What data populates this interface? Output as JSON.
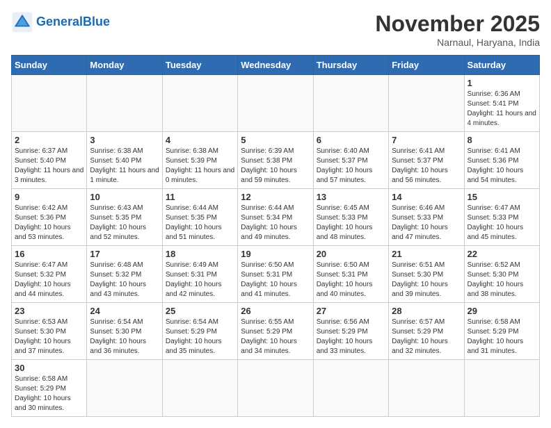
{
  "header": {
    "logo_general": "General",
    "logo_blue": "Blue",
    "month_title": "November 2025",
    "location": "Narnaul, Haryana, India"
  },
  "weekdays": [
    "Sunday",
    "Monday",
    "Tuesday",
    "Wednesday",
    "Thursday",
    "Friday",
    "Saturday"
  ],
  "days": [
    {
      "date": null,
      "number": "",
      "info": ""
    },
    {
      "date": null,
      "number": "",
      "info": ""
    },
    {
      "date": null,
      "number": "",
      "info": ""
    },
    {
      "date": null,
      "number": "",
      "info": ""
    },
    {
      "date": null,
      "number": "",
      "info": ""
    },
    {
      "date": null,
      "number": "",
      "info": ""
    },
    {
      "date": "2025-11-01",
      "number": "1",
      "info": "Sunrise: 6:36 AM\nSunset: 5:41 PM\nDaylight: 11 hours and 4 minutes."
    },
    {
      "date": "2025-11-02",
      "number": "2",
      "info": "Sunrise: 6:37 AM\nSunset: 5:40 PM\nDaylight: 11 hours and 3 minutes."
    },
    {
      "date": "2025-11-03",
      "number": "3",
      "info": "Sunrise: 6:38 AM\nSunset: 5:40 PM\nDaylight: 11 hours and 1 minute."
    },
    {
      "date": "2025-11-04",
      "number": "4",
      "info": "Sunrise: 6:38 AM\nSunset: 5:39 PM\nDaylight: 11 hours and 0 minutes."
    },
    {
      "date": "2025-11-05",
      "number": "5",
      "info": "Sunrise: 6:39 AM\nSunset: 5:38 PM\nDaylight: 10 hours and 59 minutes."
    },
    {
      "date": "2025-11-06",
      "number": "6",
      "info": "Sunrise: 6:40 AM\nSunset: 5:37 PM\nDaylight: 10 hours and 57 minutes."
    },
    {
      "date": "2025-11-07",
      "number": "7",
      "info": "Sunrise: 6:41 AM\nSunset: 5:37 PM\nDaylight: 10 hours and 56 minutes."
    },
    {
      "date": "2025-11-08",
      "number": "8",
      "info": "Sunrise: 6:41 AM\nSunset: 5:36 PM\nDaylight: 10 hours and 54 minutes."
    },
    {
      "date": "2025-11-09",
      "number": "9",
      "info": "Sunrise: 6:42 AM\nSunset: 5:36 PM\nDaylight: 10 hours and 53 minutes."
    },
    {
      "date": "2025-11-10",
      "number": "10",
      "info": "Sunrise: 6:43 AM\nSunset: 5:35 PM\nDaylight: 10 hours and 52 minutes."
    },
    {
      "date": "2025-11-11",
      "number": "11",
      "info": "Sunrise: 6:44 AM\nSunset: 5:35 PM\nDaylight: 10 hours and 51 minutes."
    },
    {
      "date": "2025-11-12",
      "number": "12",
      "info": "Sunrise: 6:44 AM\nSunset: 5:34 PM\nDaylight: 10 hours and 49 minutes."
    },
    {
      "date": "2025-11-13",
      "number": "13",
      "info": "Sunrise: 6:45 AM\nSunset: 5:33 PM\nDaylight: 10 hours and 48 minutes."
    },
    {
      "date": "2025-11-14",
      "number": "14",
      "info": "Sunrise: 6:46 AM\nSunset: 5:33 PM\nDaylight: 10 hours and 47 minutes."
    },
    {
      "date": "2025-11-15",
      "number": "15",
      "info": "Sunrise: 6:47 AM\nSunset: 5:33 PM\nDaylight: 10 hours and 45 minutes."
    },
    {
      "date": "2025-11-16",
      "number": "16",
      "info": "Sunrise: 6:47 AM\nSunset: 5:32 PM\nDaylight: 10 hours and 44 minutes."
    },
    {
      "date": "2025-11-17",
      "number": "17",
      "info": "Sunrise: 6:48 AM\nSunset: 5:32 PM\nDaylight: 10 hours and 43 minutes."
    },
    {
      "date": "2025-11-18",
      "number": "18",
      "info": "Sunrise: 6:49 AM\nSunset: 5:31 PM\nDaylight: 10 hours and 42 minutes."
    },
    {
      "date": "2025-11-19",
      "number": "19",
      "info": "Sunrise: 6:50 AM\nSunset: 5:31 PM\nDaylight: 10 hours and 41 minutes."
    },
    {
      "date": "2025-11-20",
      "number": "20",
      "info": "Sunrise: 6:50 AM\nSunset: 5:31 PM\nDaylight: 10 hours and 40 minutes."
    },
    {
      "date": "2025-11-21",
      "number": "21",
      "info": "Sunrise: 6:51 AM\nSunset: 5:30 PM\nDaylight: 10 hours and 39 minutes."
    },
    {
      "date": "2025-11-22",
      "number": "22",
      "info": "Sunrise: 6:52 AM\nSunset: 5:30 PM\nDaylight: 10 hours and 38 minutes."
    },
    {
      "date": "2025-11-23",
      "number": "23",
      "info": "Sunrise: 6:53 AM\nSunset: 5:30 PM\nDaylight: 10 hours and 37 minutes."
    },
    {
      "date": "2025-11-24",
      "number": "24",
      "info": "Sunrise: 6:54 AM\nSunset: 5:30 PM\nDaylight: 10 hours and 36 minutes."
    },
    {
      "date": "2025-11-25",
      "number": "25",
      "info": "Sunrise: 6:54 AM\nSunset: 5:29 PM\nDaylight: 10 hours and 35 minutes."
    },
    {
      "date": "2025-11-26",
      "number": "26",
      "info": "Sunrise: 6:55 AM\nSunset: 5:29 PM\nDaylight: 10 hours and 34 minutes."
    },
    {
      "date": "2025-11-27",
      "number": "27",
      "info": "Sunrise: 6:56 AM\nSunset: 5:29 PM\nDaylight: 10 hours and 33 minutes."
    },
    {
      "date": "2025-11-28",
      "number": "28",
      "info": "Sunrise: 6:57 AM\nSunset: 5:29 PM\nDaylight: 10 hours and 32 minutes."
    },
    {
      "date": "2025-11-29",
      "number": "29",
      "info": "Sunrise: 6:58 AM\nSunset: 5:29 PM\nDaylight: 10 hours and 31 minutes."
    },
    {
      "date": "2025-11-30",
      "number": "30",
      "info": "Sunrise: 6:58 AM\nSunset: 5:29 PM\nDaylight: 10 hours and 30 minutes."
    },
    {
      "date": null,
      "number": "",
      "info": ""
    },
    {
      "date": null,
      "number": "",
      "info": ""
    },
    {
      "date": null,
      "number": "",
      "info": ""
    },
    {
      "date": null,
      "number": "",
      "info": ""
    },
    {
      "date": null,
      "number": "",
      "info": ""
    },
    {
      "date": null,
      "number": "",
      "info": ""
    }
  ]
}
